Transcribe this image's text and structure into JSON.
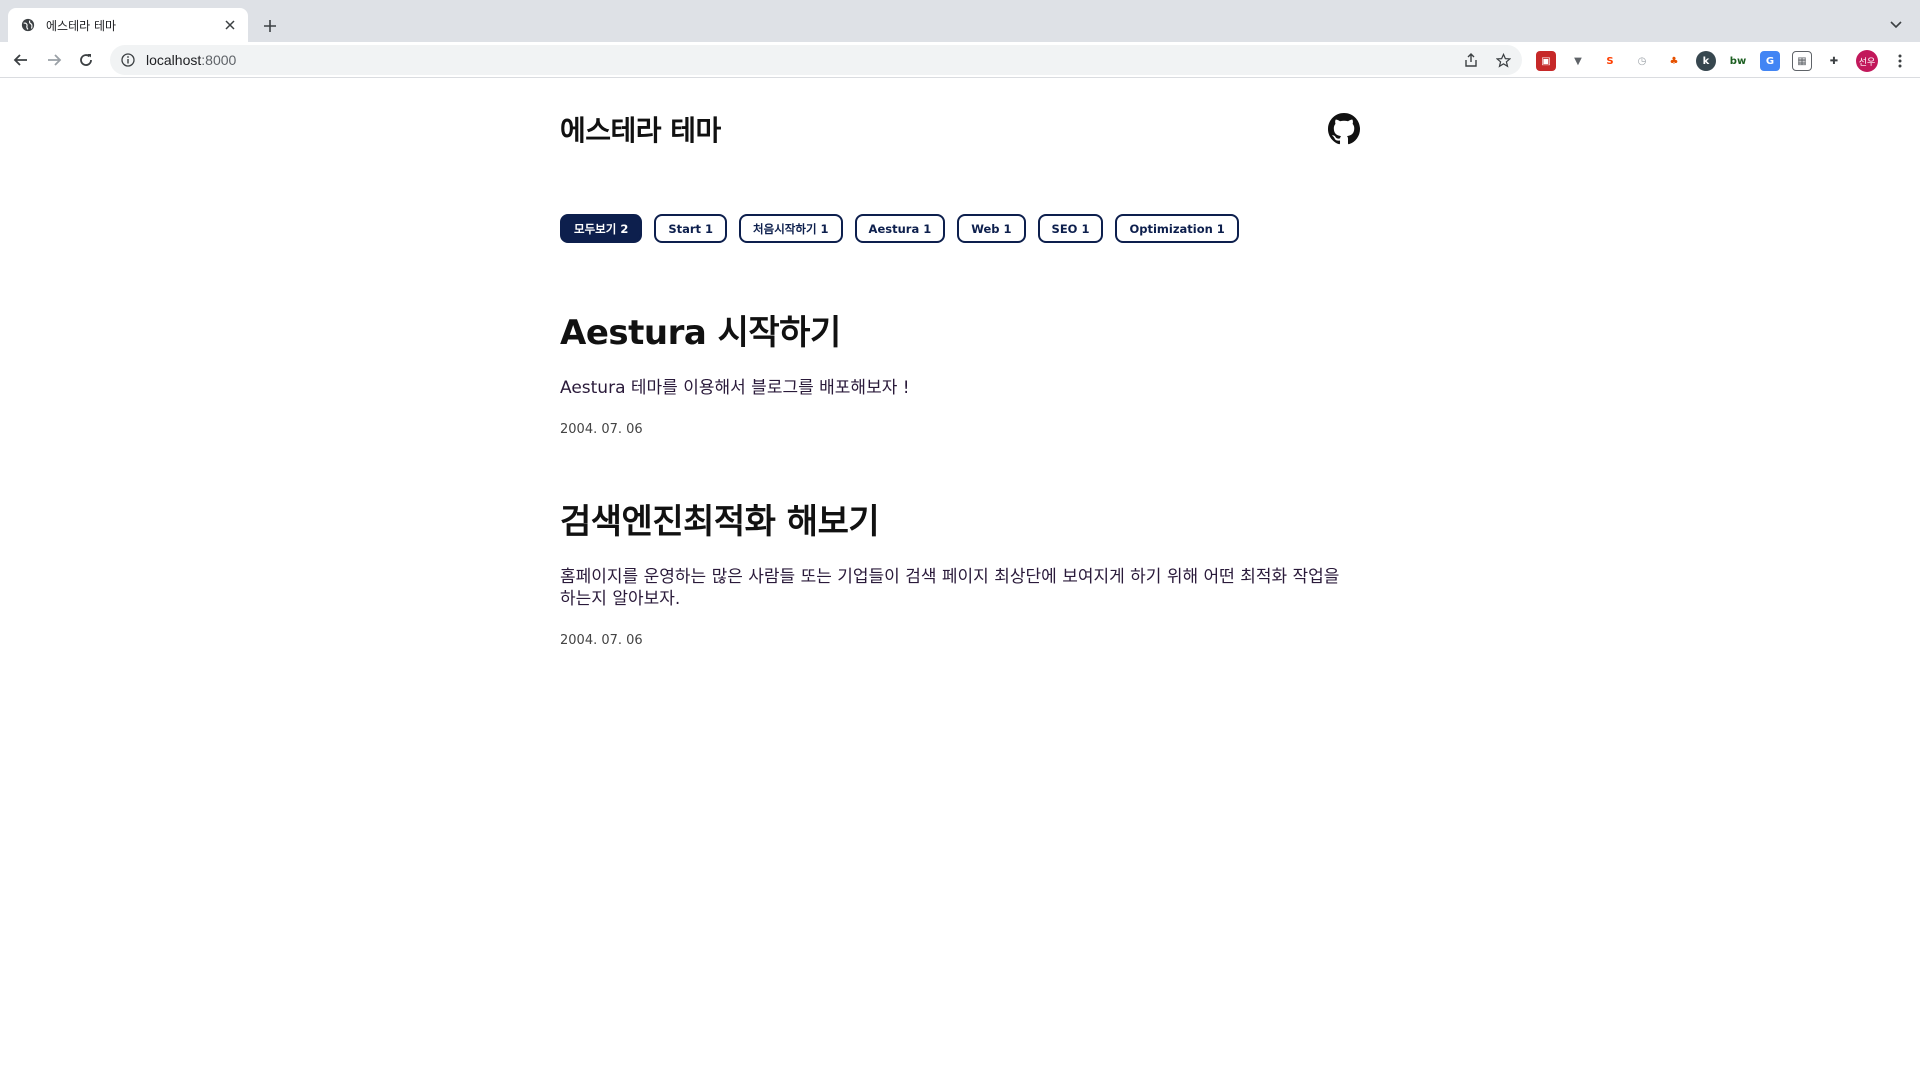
{
  "browser": {
    "tab_title": "에스테라 테마",
    "url_host": "localhost",
    "url_port": ":8000",
    "avatar_text": "선우"
  },
  "site": {
    "title": "에스테라 테마"
  },
  "categories": [
    {
      "label": "모두보기 2",
      "active": true
    },
    {
      "label": "Start 1"
    },
    {
      "label": "처음시작하기 1"
    },
    {
      "label": "Aestura 1"
    },
    {
      "label": "Web 1"
    },
    {
      "label": "SEO 1"
    },
    {
      "label": "Optimization 1"
    }
  ],
  "posts": [
    {
      "title": "Aestura 시작하기",
      "description": "Aestura 테마를 이용해서 블로그를 배포해보자 !",
      "date": "2004. 07. 06"
    },
    {
      "title": "검색엔진최적화 해보기",
      "description": "홈페이지를 운영하는 많은 사람들 또는 기업들이 검색 페이지 최상단에 보여지게 하기 위해 어떤 최적화 작업을 하는지 알아보자.",
      "date": "2004. 07. 06"
    }
  ],
  "colors": {
    "accent": "#0d1f4d",
    "tabstrip": "#dee1e6"
  }
}
